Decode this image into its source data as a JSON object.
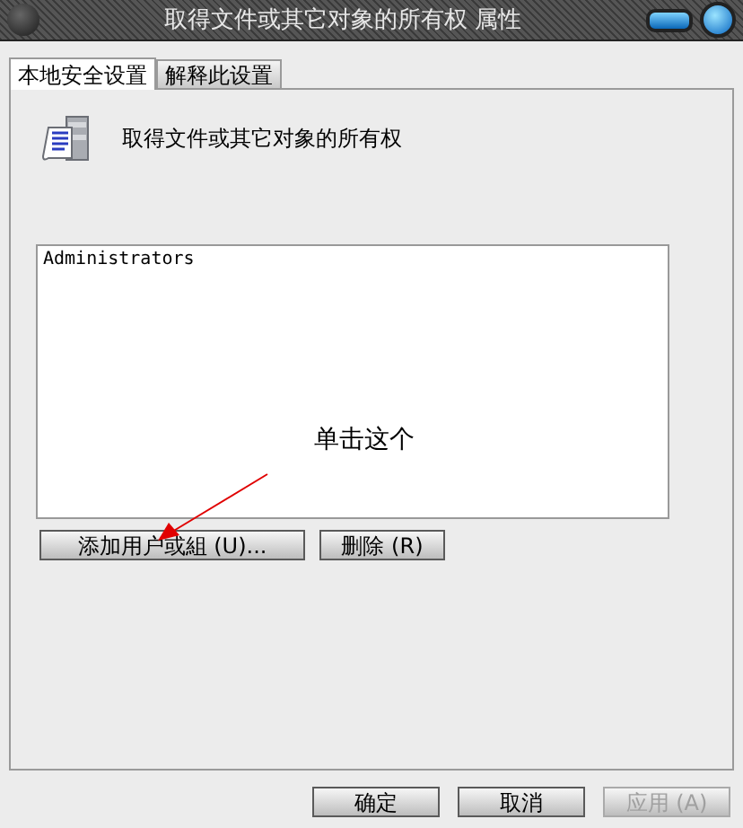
{
  "window": {
    "title": "取得文件或其它对象的所有权 属性"
  },
  "tabs": [
    {
      "label": "本地安全设置",
      "selected": true
    },
    {
      "label": "解释此设置",
      "selected": false
    }
  ],
  "policy": {
    "title": "取得文件或其它对象的所有权"
  },
  "members": [
    "Administrators"
  ],
  "member_buttons": [
    {
      "label": "添加用户或組 (U)...",
      "disabled": false
    },
    {
      "label": "删除 (R)",
      "disabled": false
    }
  ],
  "annotation": {
    "text": "单击这个"
  },
  "buttons": [
    {
      "label": "确定",
      "disabled": false
    },
    {
      "label": "取消",
      "disabled": false
    },
    {
      "label": "应用 (A)",
      "disabled": true
    }
  ]
}
